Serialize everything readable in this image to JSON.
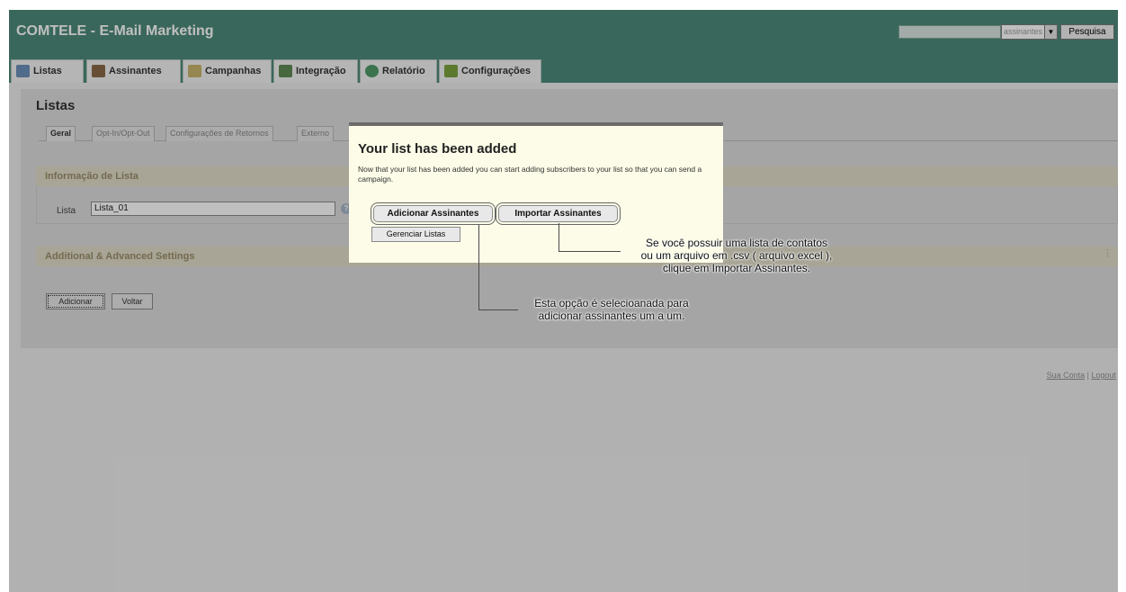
{
  "header": {
    "title": "COMTELE - E-Mail Marketing",
    "search_select_value": "assinantes",
    "search_button": "Pesquisa"
  },
  "tabs": [
    {
      "label": "Listas",
      "icon": "list-icon"
    },
    {
      "label": "Assinantes",
      "icon": "users-icon"
    },
    {
      "label": "Campanhas",
      "icon": "campaign-icon"
    },
    {
      "label": "Integração",
      "icon": "integration-icon"
    },
    {
      "label": "Relatório",
      "icon": "report-icon"
    },
    {
      "label": "Configurações",
      "icon": "settings-icon"
    }
  ],
  "page": {
    "title": "Listas",
    "subtabs": [
      "Geral",
      "Opt-In/Opt-Out",
      "Configurações de Retornos",
      "Externo"
    ],
    "section_info": "Informação de Lista",
    "lista_label": "Lista",
    "lista_value": "Lista_01",
    "section_advanced": "Additional & Advanced Settings",
    "btn_add": "Adicionar",
    "btn_back": "Voltar"
  },
  "modal": {
    "title": "Your list has been added",
    "message": "Now that your list has been added you can start adding subscribers to your list so that you can send a campaign.",
    "btn_add_subscribers": "Adicionar Assinantes",
    "btn_import_subscribers": "Importar Assinantes",
    "btn_manage_lists": "Gerenciar Listas"
  },
  "annotations": {
    "import_line1": "Se você possuir uma lista de contatos",
    "import_line2": "ou um arquivo em .csv ( arquivo excel ),",
    "import_line3": "clique em Importar Assinantes.",
    "add_line1": "Esta opção é selecioanada para",
    "add_line2": "adicionar assinantes um a um."
  },
  "footer": {
    "account": "Sua Conta",
    "separator": "|",
    "logout": "Logout"
  },
  "colors": {
    "header_bg": "#4e8a7a",
    "modal_bg": "#fcfce8",
    "section_bar": "#e0dcc8"
  }
}
